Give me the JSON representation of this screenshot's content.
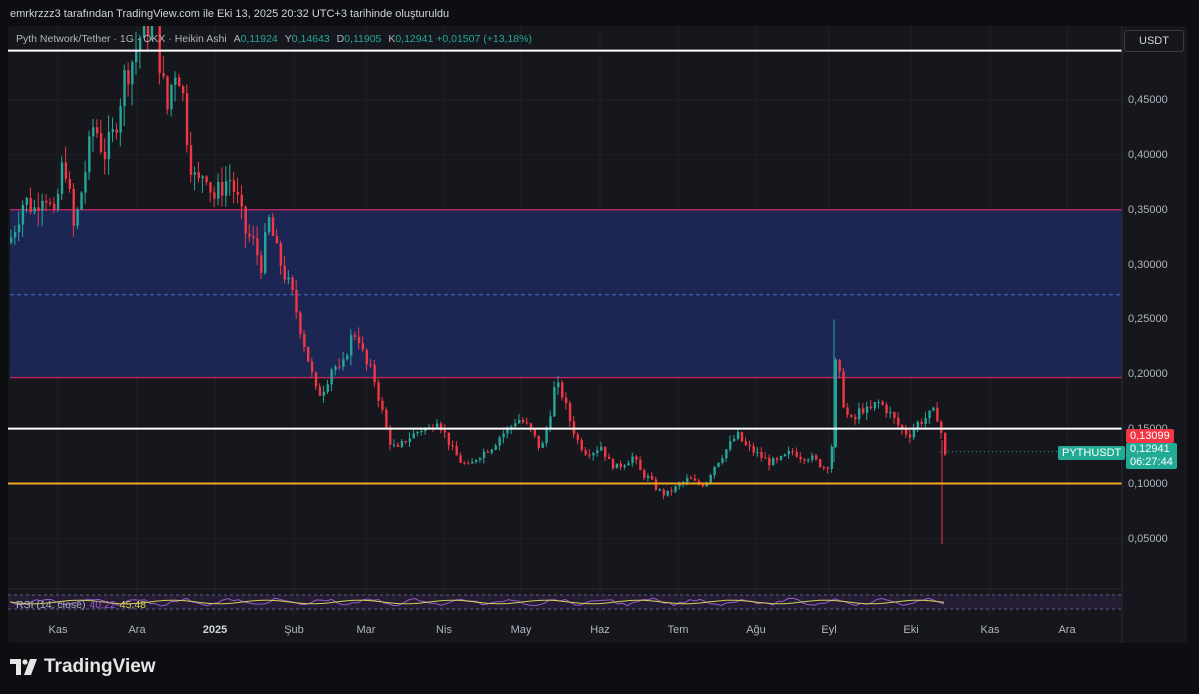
{
  "caption": "emrkrzzz3 tarafından TradingView.com ile Eki 13, 2025 20:32 UTC+3 tarihinde oluşturuldu",
  "legend": {
    "symbol": "Pyth Network/Tether · 1G · OKX · Heikin Ashi",
    "o_label": "A",
    "o": "0,11924",
    "h_label": "Y",
    "h": "0,14643",
    "l_label": "D",
    "l": "0,11905",
    "c_label": "K",
    "c": "0,12941",
    "change": "+0,01507 (+13,18%)"
  },
  "rsi_legend": {
    "label": "RSI (14, close)",
    "v1": "40,22",
    "v2": "45,48"
  },
  "currency": "USDT",
  "badges": {
    "price_line": "0,13099",
    "symbol": "PYTHUSDT",
    "last": "0,12941",
    "countdown": "06:27:44"
  },
  "footer": {
    "brand": "TradingView"
  },
  "colors": {
    "up": "#26a69a",
    "down": "#f23645",
    "zone": "#1c2a5c",
    "zone_border": "#b3245e",
    "support": "#f5a623",
    "resistance": "#ffffff"
  },
  "chart_data": {
    "type": "candlestick",
    "style": "Heikin Ashi",
    "y_ticks": [
      "0,45000",
      "0,40000",
      "0,35000",
      "0,30000",
      "0,25000",
      "0,20000",
      "0,15000",
      "0,10000",
      "0,05000"
    ],
    "y_tick_values": [
      0.45,
      0.4,
      0.35,
      0.3,
      0.25,
      0.2,
      0.15,
      0.1,
      0.05
    ],
    "x_ticks": [
      "Kas",
      "Ara",
      "2025",
      "Şub",
      "Mar",
      "Nis",
      "May",
      "Haz",
      "Tem",
      "Ağu",
      "Eyl",
      "Eki",
      "Kas",
      "Ara"
    ],
    "ylim": [
      0.0,
      0.5
    ],
    "levels": {
      "top_resistance": 0.495,
      "zone_top": 0.35,
      "zone_mid": 0.2725,
      "zone_bottom": 0.197,
      "resistance": 0.1505,
      "support": 0.1005
    },
    "price_path": [
      [
        0,
        0.32
      ],
      [
        8,
        0.34
      ],
      [
        15,
        0.36
      ],
      [
        25,
        0.35
      ],
      [
        35,
        0.37
      ],
      [
        45,
        0.34
      ],
      [
        55,
        0.4
      ],
      [
        65,
        0.33
      ],
      [
        75,
        0.38
      ],
      [
        85,
        0.43
      ],
      [
        95,
        0.4
      ],
      [
        105,
        0.42
      ],
      [
        115,
        0.47
      ],
      [
        125,
        0.49
      ],
      [
        135,
        0.52
      ],
      [
        145,
        0.52
      ],
      [
        150,
        0.49
      ],
      [
        158,
        0.44
      ],
      [
        165,
        0.48
      ],
      [
        172,
        0.47
      ],
      [
        180,
        0.4
      ],
      [
        188,
        0.37
      ],
      [
        196,
        0.39
      ],
      [
        204,
        0.36
      ],
      [
        212,
        0.37
      ],
      [
        220,
        0.38
      ],
      [
        228,
        0.36
      ],
      [
        236,
        0.33
      ],
      [
        244,
        0.32
      ],
      [
        252,
        0.3
      ],
      [
        260,
        0.34
      ],
      [
        268,
        0.31
      ],
      [
        276,
        0.29
      ],
      [
        284,
        0.27
      ],
      [
        292,
        0.24
      ],
      [
        300,
        0.21
      ],
      [
        308,
        0.18
      ],
      [
        316,
        0.19
      ],
      [
        324,
        0.21
      ],
      [
        332,
        0.2
      ],
      [
        340,
        0.23
      ],
      [
        348,
        0.24
      ],
      [
        356,
        0.21
      ],
      [
        364,
        0.2
      ],
      [
        372,
        0.17
      ],
      [
        380,
        0.14
      ],
      [
        388,
        0.13
      ],
      [
        396,
        0.14
      ],
      [
        404,
        0.145
      ],
      [
        412,
        0.15
      ],
      [
        420,
        0.15
      ],
      [
        428,
        0.16
      ],
      [
        436,
        0.145
      ],
      [
        444,
        0.13
      ],
      [
        452,
        0.12
      ],
      [
        460,
        0.115
      ],
      [
        468,
        0.125
      ],
      [
        476,
        0.13
      ],
      [
        484,
        0.135
      ],
      [
        492,
        0.145
      ],
      [
        500,
        0.15
      ],
      [
        508,
        0.16
      ],
      [
        516,
        0.155
      ],
      [
        524,
        0.145
      ],
      [
        532,
        0.13
      ],
      [
        540,
        0.16
      ],
      [
        546,
        0.19
      ],
      [
        552,
        0.185
      ],
      [
        560,
        0.16
      ],
      [
        568,
        0.14
      ],
      [
        576,
        0.13
      ],
      [
        584,
        0.13
      ],
      [
        592,
        0.135
      ],
      [
        600,
        0.12
      ],
      [
        608,
        0.115
      ],
      [
        616,
        0.12
      ],
      [
        624,
        0.125
      ],
      [
        632,
        0.11
      ],
      [
        640,
        0.105
      ],
      [
        648,
        0.095
      ],
      [
        656,
        0.09
      ],
      [
        664,
        0.095
      ],
      [
        672,
        0.1
      ],
      [
        680,
        0.105
      ],
      [
        688,
        0.1
      ],
      [
        696,
        0.1
      ],
      [
        704,
        0.115
      ],
      [
        712,
        0.125
      ],
      [
        720,
        0.135
      ],
      [
        728,
        0.145
      ],
      [
        736,
        0.135
      ],
      [
        744,
        0.13
      ],
      [
        752,
        0.125
      ],
      [
        760,
        0.12
      ],
      [
        768,
        0.12
      ],
      [
        776,
        0.125
      ],
      [
        784,
        0.13
      ],
      [
        792,
        0.125
      ],
      [
        800,
        0.125
      ],
      [
        808,
        0.12
      ],
      [
        816,
        0.115
      ],
      [
        822,
        0.12
      ],
      [
        826,
        0.21
      ],
      [
        830,
        0.2
      ],
      [
        836,
        0.165
      ],
      [
        844,
        0.155
      ],
      [
        852,
        0.17
      ],
      [
        860,
        0.165
      ],
      [
        868,
        0.175
      ],
      [
        876,
        0.17
      ],
      [
        884,
        0.16
      ],
      [
        892,
        0.15
      ],
      [
        900,
        0.145
      ],
      [
        908,
        0.155
      ],
      [
        916,
        0.16
      ],
      [
        924,
        0.165
      ],
      [
        930,
        0.16
      ],
      [
        934,
        0.135
      ],
      [
        938,
        0.115
      ],
      [
        942,
        0.13
      ]
    ],
    "rsi": {
      "upper": 70,
      "lower": 30
    }
  }
}
